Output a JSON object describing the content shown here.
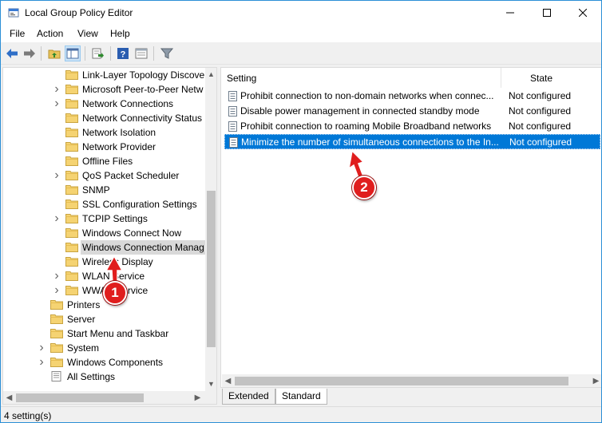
{
  "window": {
    "title": "Local Group Policy Editor"
  },
  "menu": {
    "items": [
      "File",
      "Action",
      "View",
      "Help"
    ]
  },
  "toolbar": {
    "buttons": [
      "back-icon",
      "forward-icon",
      "up-folder-icon",
      "show-hide-tree-icon",
      "export-list-icon",
      "help-icon",
      "properties-icon",
      "filter-icon"
    ]
  },
  "tree": {
    "items": [
      {
        "label": "Link-Layer Topology Discove",
        "expandable": false
      },
      {
        "label": "Microsoft Peer-to-Peer Netw",
        "expandable": true
      },
      {
        "label": "Network Connections",
        "expandable": true
      },
      {
        "label": "Network Connectivity Status",
        "expandable": false
      },
      {
        "label": "Network Isolation",
        "expandable": false
      },
      {
        "label": "Network Provider",
        "expandable": false
      },
      {
        "label": "Offline Files",
        "expandable": false
      },
      {
        "label": "QoS Packet Scheduler",
        "expandable": true
      },
      {
        "label": "SNMP",
        "expandable": false
      },
      {
        "label": "SSL Configuration Settings",
        "expandable": false
      },
      {
        "label": "TCPIP Settings",
        "expandable": true
      },
      {
        "label": "Windows Connect Now",
        "expandable": false
      },
      {
        "label": "Windows Connection Manag",
        "expandable": false,
        "selected": true
      },
      {
        "label": "Wireless Display",
        "expandable": false
      },
      {
        "label": "WLAN Service",
        "expandable": true
      },
      {
        "label": "WWAN Service",
        "expandable": true
      },
      {
        "label": "Printers",
        "expandable": false
      },
      {
        "label": "Server",
        "expandable": false
      },
      {
        "label": "Start Menu and Taskbar",
        "expandable": false
      },
      {
        "label": "System",
        "expandable": true
      },
      {
        "label": "Windows Components",
        "expandable": true
      },
      {
        "label": "All Settings",
        "expandable": false
      }
    ]
  },
  "list": {
    "columns": {
      "setting": "Setting",
      "state": "State"
    },
    "rows": [
      {
        "setting": "Prohibit connection to non-domain networks when connec...",
        "state": "Not configured"
      },
      {
        "setting": "Disable power management in connected standby mode",
        "state": "Not configured"
      },
      {
        "setting": "Prohibit connection to roaming Mobile Broadband networks",
        "state": "Not configured"
      },
      {
        "setting": "Minimize the number of simultaneous connections to the In...",
        "state": "Not configured",
        "selected": true
      }
    ]
  },
  "tabs": {
    "extended": "Extended",
    "standard": "Standard"
  },
  "status": {
    "text": "4 setting(s)"
  },
  "annotations": {
    "marker1": "1",
    "marker2": "2"
  },
  "colors": {
    "selection": "#0078d7",
    "marker": "#e01e1e",
    "window_border": "#2b8fd6"
  }
}
